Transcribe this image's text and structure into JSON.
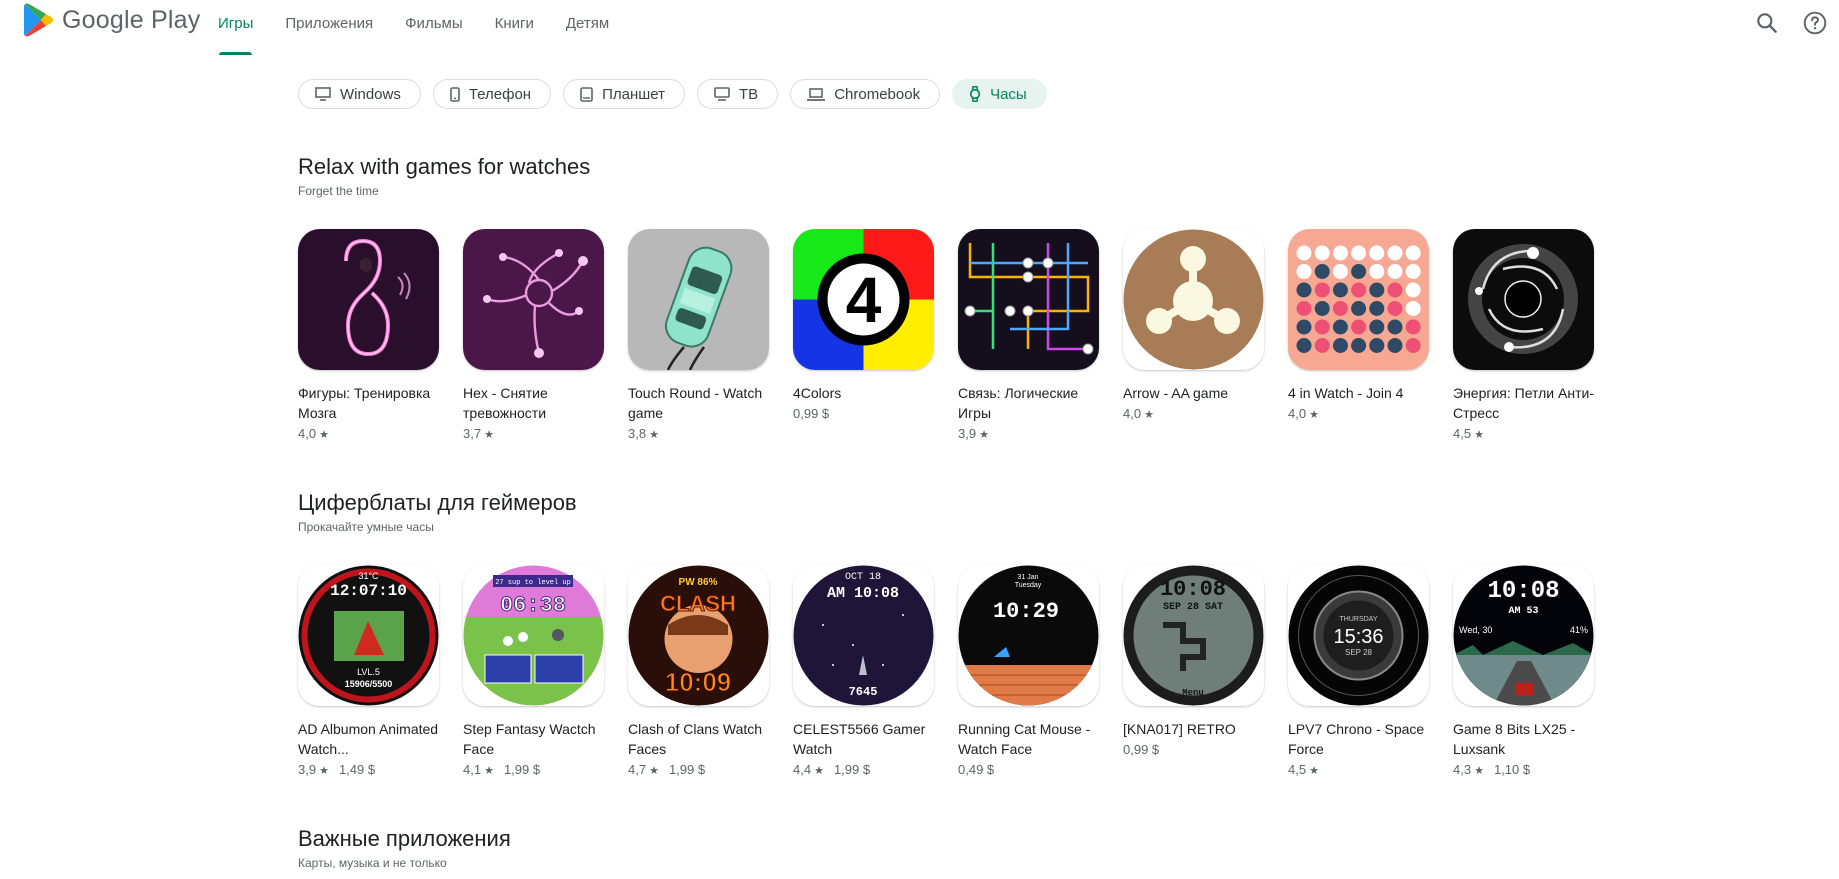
{
  "header": {
    "brand": "Google Play",
    "nav": [
      "Игры",
      "Приложения",
      "Фильмы",
      "Книги",
      "Детям"
    ],
    "active_nav": "Игры"
  },
  "devices": [
    {
      "label": "Windows",
      "icon": "monitor-icon"
    },
    {
      "label": "Телефон",
      "icon": "phone-icon"
    },
    {
      "label": "Планшет",
      "icon": "tablet-icon"
    },
    {
      "label": "ТВ",
      "icon": "tv-icon"
    },
    {
      "label": "Chromebook",
      "icon": "laptop-icon"
    },
    {
      "label": "Часы",
      "icon": "watch-icon",
      "selected": true
    }
  ],
  "sections": [
    {
      "title": "Relax with games for watches",
      "subtitle": "Forget the time",
      "apps": [
        {
          "name": "Фигуры: Тренировка Мозга",
          "rating": "4,0"
        },
        {
          "name": "Hex - Снятие тревожности",
          "rating": "3,7"
        },
        {
          "name": "Touch Round - Watch game",
          "rating": "3,8"
        },
        {
          "name": "4Colors",
          "price": "0,99 $"
        },
        {
          "name": "Связь: Логические Игры",
          "rating": "3,9"
        },
        {
          "name": "Arrow - AA game",
          "rating": "4,0"
        },
        {
          "name": "4 in Watch - Join 4",
          "rating": "4,0"
        },
        {
          "name": "Энергия: Петли Анти-Стресс",
          "rating": "4,5"
        }
      ]
    },
    {
      "title": "Циферблаты для геймеров",
      "subtitle": "Прокачайте умные часы",
      "apps": [
        {
          "name": "AD Albumon Animated Watch...",
          "rating": "3,9",
          "price": "1,49 $",
          "face": [
            "31°C",
            "12:07:10",
            "LVL.5",
            "15906/5500"
          ]
        },
        {
          "name": "Step Fantasy Wactch Face",
          "rating": "4,1",
          "price": "1,99 $",
          "face": [
            "27 sup to level up",
            "06:38"
          ]
        },
        {
          "name": "Clash of Clans Watch Faces",
          "rating": "4,7",
          "price": "1,99 $",
          "face": [
            "PW 86%",
            "CLASH",
            "10:09"
          ]
        },
        {
          "name": "CELEST5566 Gamer Watch",
          "rating": "4,4",
          "price": "1,99 $",
          "face": [
            "OCT 18",
            "AM 10:08",
            "7645"
          ]
        },
        {
          "name": "Running Cat Mouse - Watch Face",
          "price": "0,49 $",
          "face": [
            "31 Jan",
            "Tuesday",
            "10:29"
          ]
        },
        {
          "name": "[KNA017] RETRO",
          "price": "0,99 $",
          "face": [
            "10:08",
            "SEP 28 SAT",
            "Menu"
          ]
        },
        {
          "name": "LPV7 Chrono - Space Force",
          "rating": "4,5",
          "face": [
            "THURSDAY",
            "15:36",
            "SEP 28"
          ]
        },
        {
          "name": "Game 8 Bits LX25 - Luxsank",
          "rating": "4,3",
          "price": "1,10 $",
          "face": [
            "10:08",
            "AM 53",
            "Wed, 30",
            "41%"
          ]
        }
      ]
    },
    {
      "title": "Важные приложения",
      "subtitle": "Карты, музыка и не только"
    }
  ],
  "colors": {
    "accent": "#01875f",
    "chip_active_bg": "#e6f3ef"
  }
}
